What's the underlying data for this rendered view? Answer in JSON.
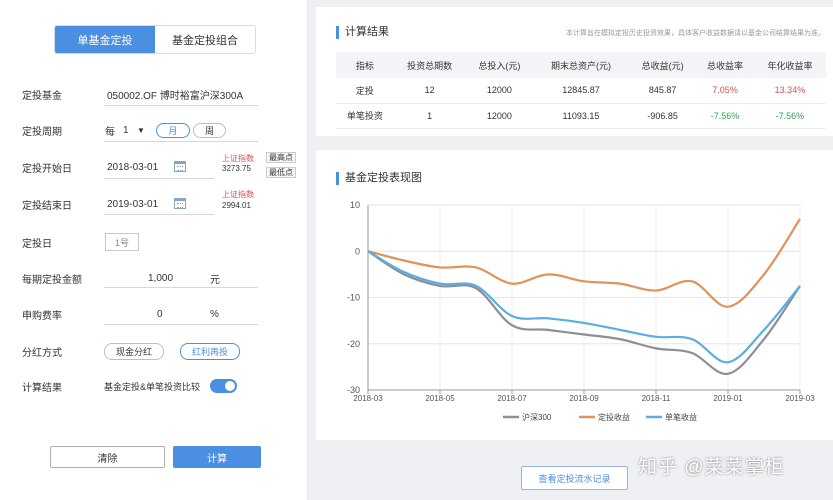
{
  "tabs": [
    {
      "label": "单基金定投"
    },
    {
      "label": "基金定投组合"
    }
  ],
  "form": {
    "fund": {
      "label": "定投基金",
      "value": "050002.OF 博时裕富沪深300A"
    },
    "period": {
      "label": "定投周期",
      "prefix": "每",
      "count": "1",
      "caret": "▼",
      "unit_month": "月",
      "unit_week": "周"
    },
    "start": {
      "label": "定投开始日",
      "value": "2018-03-01",
      "index_label": "上证指数",
      "index_value": "3273.75",
      "high": "最高点",
      "low": "最低点"
    },
    "end": {
      "label": "定投结束日",
      "value": "2019-03-01",
      "index_label": "上证指数",
      "index_value": "2994.01"
    },
    "day": {
      "label": "定投日",
      "value": "1号"
    },
    "amount": {
      "label": "每期定投金额",
      "value": "1,000",
      "unit": "元"
    },
    "fee": {
      "label": "申购费率",
      "value": "0",
      "unit": "%"
    },
    "dividend": {
      "label": "分红方式",
      "option_cash": "现金分红",
      "option_reinvest": "红利再投"
    },
    "result": {
      "label": "计算结果",
      "value": "基金定投&单笔投资比较",
      "toggle_on": true
    }
  },
  "buttons": {
    "clear": "清除",
    "calc": "计算",
    "flow": "查看定投流水记录"
  },
  "results": {
    "title": "计算结果",
    "note": "本计算旨在模拟定投历史投资效果，具体客户收益数据请以基金公司结算结果为准。",
    "headers": [
      "指标",
      "投资总期数",
      "总投入(元)",
      "期末总资产(元)",
      "总收益(元)",
      "总收益率",
      "年化收益率"
    ],
    "rows": [
      [
        "定投",
        "12",
        "12000",
        "12845.87",
        "845.87",
        "7.05%",
        "13.34%"
      ],
      [
        "单笔投资",
        "1",
        "12000",
        "11093.15",
        "-906.85",
        "-7.56%",
        "-7.56%"
      ]
    ]
  },
  "chart_title": "基金定投表现图",
  "chart_data": {
    "type": "line",
    "x": [
      "2018-03",
      "2018-04",
      "2018-05",
      "2018-06",
      "2018-07",
      "2018-08",
      "2018-09",
      "2018-10",
      "2018-11",
      "2018-12",
      "2019-01",
      "2019-02",
      "2019-03"
    ],
    "xticks": [
      "2018-03",
      "2018-05",
      "2018-07",
      "2018-09",
      "2018-11",
      "2019-01",
      "2019-03"
    ],
    "ylim": [
      -30,
      10
    ],
    "yticks": [
      10,
      0,
      -10,
      -20,
      -30
    ],
    "grid": true,
    "legend_position": "bottom",
    "series": [
      {
        "name": "沪深300",
        "color": "#8e8e96",
        "values": [
          0,
          -5,
          -7.5,
          -8,
          -16,
          -17,
          -18,
          -19,
          -21,
          -22,
          -26.5,
          -19,
          -7.5
        ]
      },
      {
        "name": "定投收益",
        "color": "#e0925a",
        "values": [
          0,
          -2,
          -3.5,
          -3.5,
          -7,
          -5,
          -6.5,
          -7,
          -8.5,
          -6.5,
          -12,
          -5,
          7
        ]
      },
      {
        "name": "单笔收益",
        "color": "#5aaee0",
        "values": [
          0,
          -4.5,
          -7,
          -7.5,
          -14,
          -14.5,
          -15.5,
          -17,
          -18.5,
          -19,
          -24,
          -17,
          -7.5
        ]
      }
    ]
  },
  "watermark": "知乎 @菜菜掌柜"
}
